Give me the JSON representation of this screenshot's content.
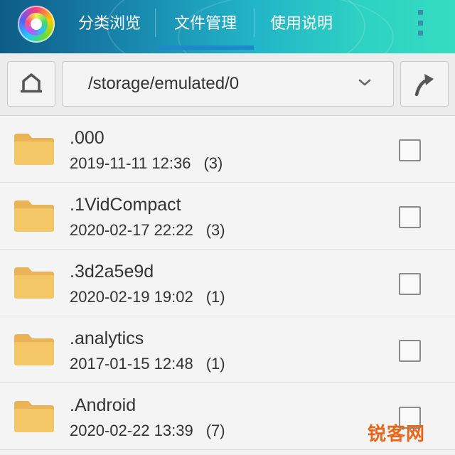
{
  "header": {
    "tabs": [
      {
        "label": "分类浏览"
      },
      {
        "label": "文件管理"
      },
      {
        "label": "使用说明"
      }
    ],
    "active_tab": 1,
    "accent": "#1e88c8"
  },
  "pathbar": {
    "path": "/storage/emulated/0",
    "home_icon": "home-icon",
    "up_icon": "up-arrow-icon",
    "dropdown_icon": "chevron-down-icon"
  },
  "files": [
    {
      "name": ".000",
      "date": "2019-11-11 12:36",
      "count": "(3)"
    },
    {
      "name": ".1VidCompact",
      "date": "2020-02-17 22:22",
      "count": "(3)"
    },
    {
      "name": ".3d2a5e9d",
      "date": "2020-02-19 19:02",
      "count": "(1)"
    },
    {
      "name": ".analytics",
      "date": "2017-01-15 12:48",
      "count": "(1)"
    },
    {
      "name": ".Android",
      "date": "2020-02-22 13:39",
      "count": "(7)"
    }
  ],
  "colors": {
    "folder": "#f0c060",
    "watermark": "#e8651a"
  },
  "watermark": "锐客网"
}
